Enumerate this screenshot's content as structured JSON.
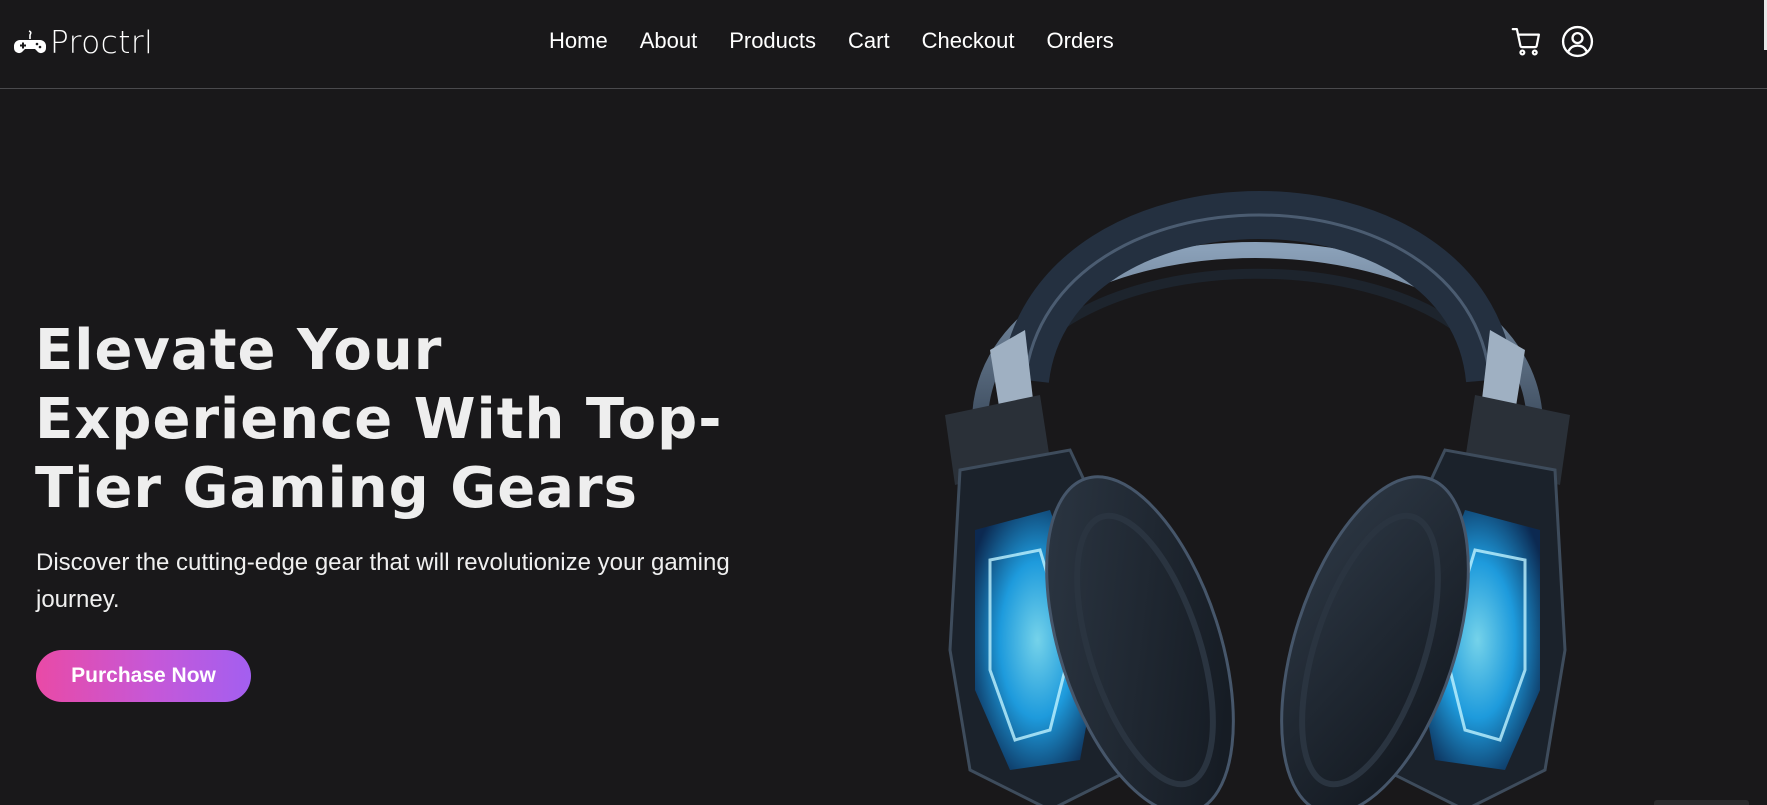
{
  "brand": {
    "name": "Proctrl",
    "logo_icon": "gamepad-icon"
  },
  "nav": {
    "links": [
      "Home",
      "About",
      "Products",
      "Cart",
      "Checkout",
      "Orders"
    ],
    "icons": [
      "cart-icon",
      "user-icon"
    ]
  },
  "hero": {
    "title": "Elevate Your Experience With Top-Tier Gaming Gears",
    "subtitle": "Discover the cutting-edge gear that will revolutionize your gaming journey.",
    "cta_label": "Purchase Now",
    "image_icon": "gaming-headset-image"
  },
  "colors": {
    "background": "#19181a",
    "cta_gradient_start": "#e94aa6",
    "cta_gradient_end": "#a35ff0",
    "headset_glow": "#1ec8ff"
  }
}
